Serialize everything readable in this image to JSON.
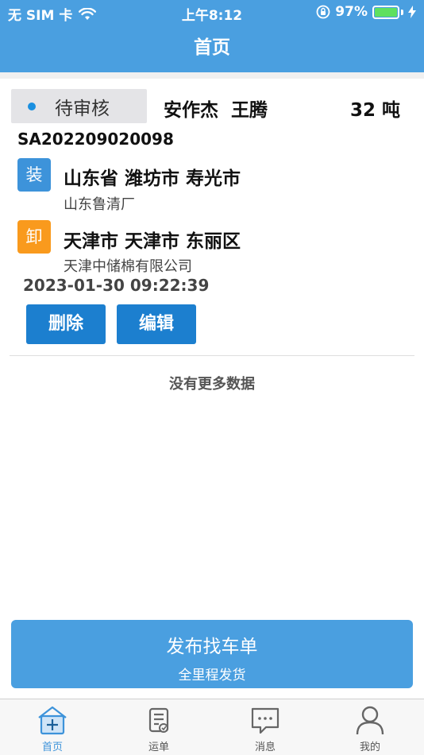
{
  "status_bar": {
    "carrier": "无 SIM 卡",
    "time": "上午8:12",
    "battery": "97%"
  },
  "header": {
    "title": "首页"
  },
  "order": {
    "status": "待审核",
    "shipper": "安作杰",
    "driver": "王腾",
    "weight": "32 吨",
    "order_no": "SA202209020098",
    "load": {
      "badge": "装",
      "address": "山东省 潍坊市 寿光市",
      "company": "山东鲁清厂"
    },
    "unload": {
      "badge": "卸",
      "address": "天津市 天津市 东丽区",
      "company": "天津中储棉有限公司"
    },
    "datetime": "2023-01-30 09:22:39",
    "actions": {
      "delete": "删除",
      "edit": "编辑"
    }
  },
  "list_footer": "没有更多数据",
  "publish": {
    "title": "发布找车单",
    "subtitle": "全里程发货"
  },
  "tabs": [
    {
      "label": "首页",
      "icon": "home-plus-icon"
    },
    {
      "label": "运单",
      "icon": "waybill-icon"
    },
    {
      "label": "消息",
      "icon": "message-icon"
    },
    {
      "label": "我的",
      "icon": "profile-icon"
    }
  ],
  "colors": {
    "primary": "#4a9fe0",
    "button": "#1c7fcf",
    "load_badge": "#3d93da",
    "unload_badge": "#f99a1d",
    "status_dot": "#1a8fe0"
  }
}
